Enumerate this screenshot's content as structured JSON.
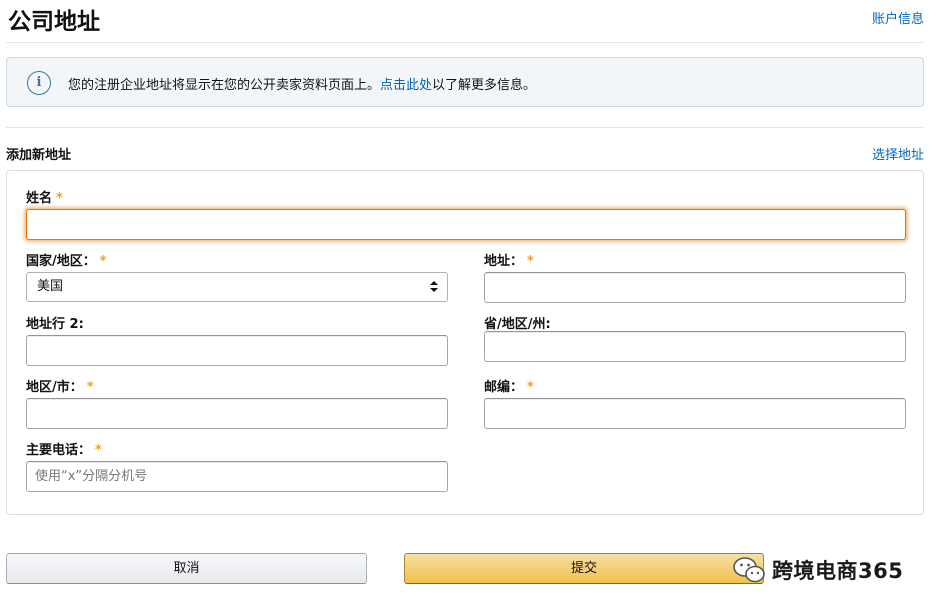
{
  "header": {
    "title": "公司地址",
    "account_link": "账户信息"
  },
  "info": {
    "icon": "info-icon",
    "icon_glyph": "i",
    "text_before": "您的注册企业地址将显示在您的公开卖家资料页面上。",
    "link": "点击此处",
    "text_after": "以了解更多信息。"
  },
  "section": {
    "title": "添加新地址",
    "select_link": "选择地址"
  },
  "form": {
    "required_mark": "*",
    "name_label": "姓名",
    "name_value": "",
    "country_label": "国家/地区：",
    "country_value": "美国",
    "address_label": "地址：",
    "address_value": "",
    "address2_label": "地址行 2:",
    "address2_value": "",
    "state_label": "省/地区/州:",
    "state_value": "",
    "city_label": "地区/市：",
    "city_value": "",
    "zip_label": "邮编：",
    "zip_value": "",
    "phone_label": "主要电话：",
    "phone_value": "",
    "phone_placeholder": "使用“x”分隔分机号"
  },
  "buttons": {
    "cancel": "取消",
    "submit": "提交"
  },
  "watermark": {
    "text": "跨境电商365"
  },
  "colors": {
    "link": "#0066c0",
    "required": "#e7a325",
    "focus": "#e77600",
    "submit_bg": "#f0c14b"
  }
}
